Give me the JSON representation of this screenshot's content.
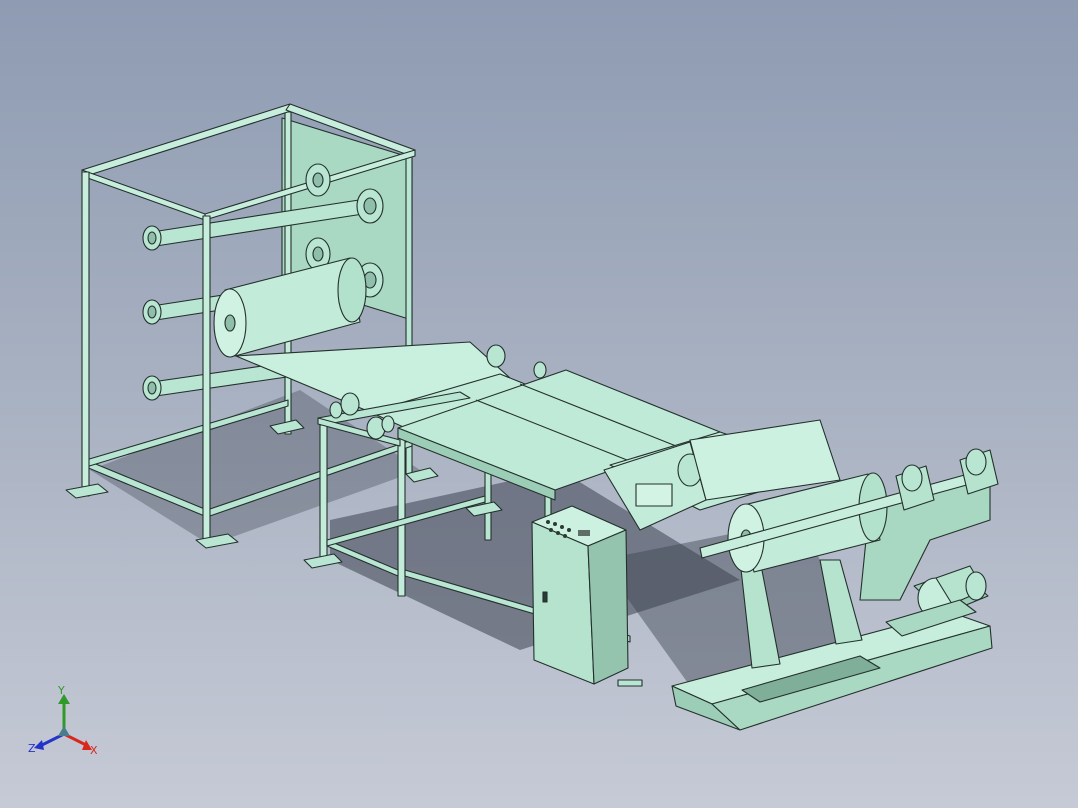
{
  "viewport": {
    "background_top": "#8e9bb2",
    "background_bottom": "#c6cad6"
  },
  "model": {
    "part_color": "#b8e6d2",
    "edge_color": "#24302c",
    "shadow_color": "#3c4250"
  },
  "triad": {
    "x_label": "X",
    "y_label": "Y",
    "z_label": "Z",
    "x_color": "#d8281e",
    "y_color": "#2f9a2a",
    "z_color": "#2434c8"
  }
}
